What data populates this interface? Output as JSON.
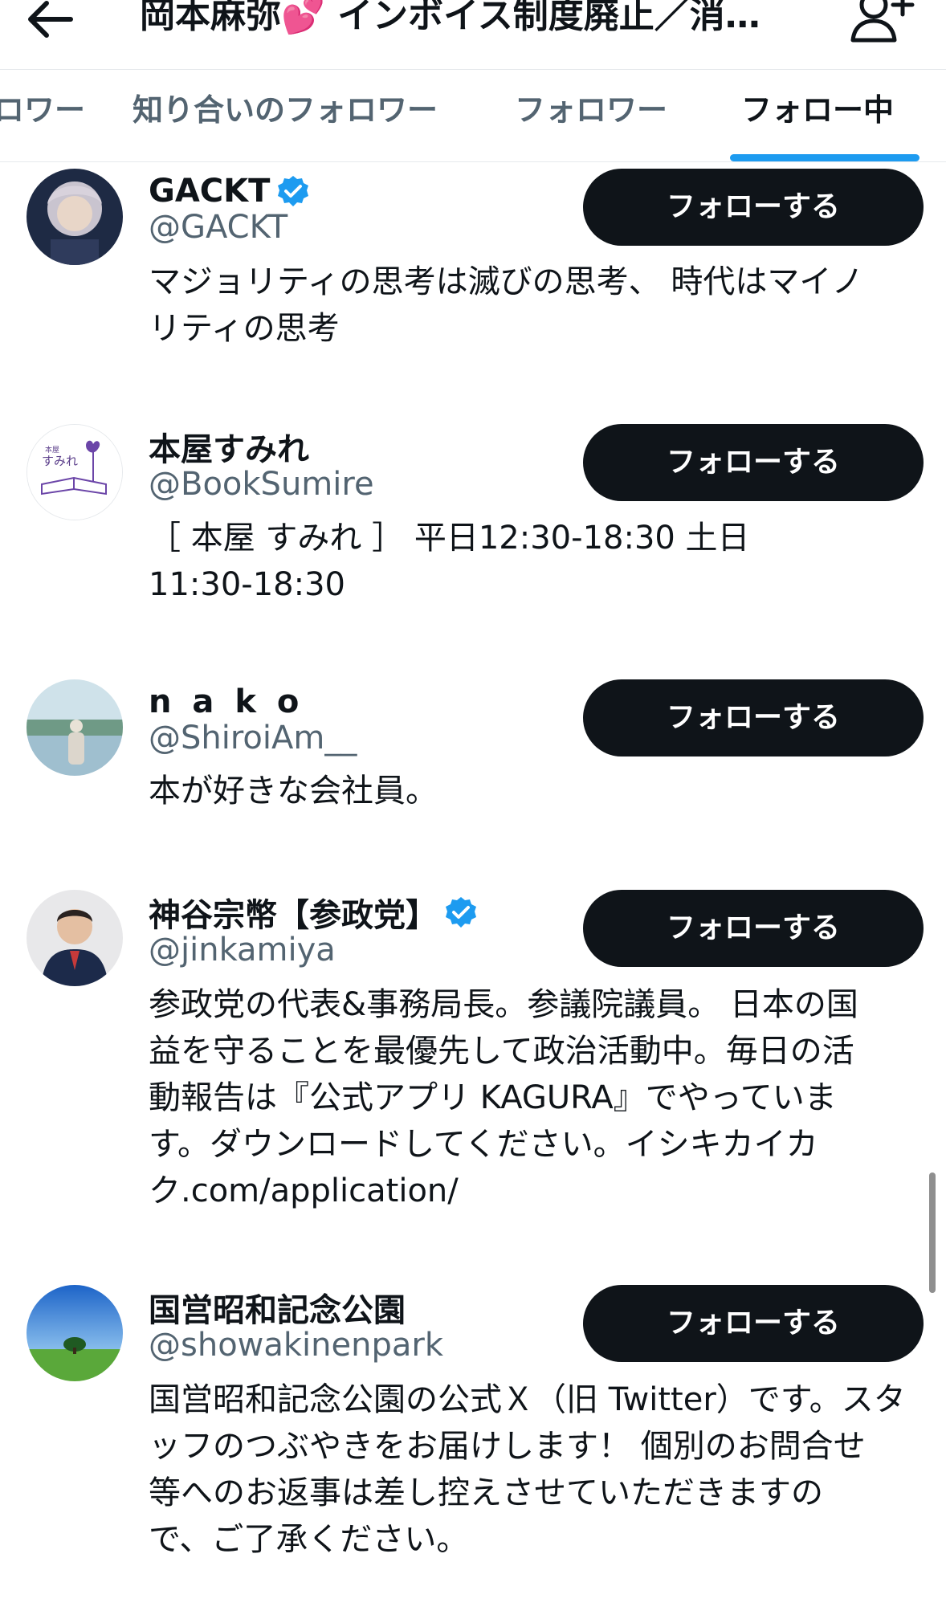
{
  "header": {
    "title": "岡本麻弥💕 インボイス制度廃止／消…"
  },
  "tabs": [
    {
      "label": "ロワー"
    },
    {
      "label": "知り合いのフォロワー"
    },
    {
      "label": "フォロワー"
    },
    {
      "label": "フォロー中"
    }
  ],
  "users": [
    {
      "name": "GACKT",
      "handle": "@GACKT",
      "verified": true,
      "button": "フォローする",
      "bio": [
        "マジョリティの思考は滅びの思考、 時代はマイノ",
        "リティの思考"
      ]
    },
    {
      "name": "本屋すみれ",
      "handle": "@BookSumire",
      "verified": false,
      "button": "フォローする",
      "bio": [
        "［ 本屋 すみれ ］ 平日12:30-18:30 土日",
        "11:30-18:30"
      ],
      "avatar_text": [
        "本屋",
        "すみれ"
      ]
    },
    {
      "name": "n a k o",
      "handle": "@ShiroiAm__",
      "verified": false,
      "button": "フォローする",
      "bio": [
        "本が好きな会社員。"
      ]
    },
    {
      "name": "神谷宗幣【参政党】",
      "handle": "@jinkamiya",
      "verified": true,
      "button": "フォローする",
      "bio": [
        "参政党の代表&事務局長。参議院議員。 日本の国",
        "益を守ることを最優先して政治活動中。毎日の活",
        "動報告は『公式アプリ KAGURA』でやっていま",
        "す。ダウンロードしてください。イシキカイカ",
        "ク.com/application/"
      ]
    },
    {
      "name": "国営昭和記念公園",
      "handle": "@showakinenpark",
      "verified": false,
      "button": "フォローする",
      "bio": [
        "国営昭和記念公園の公式Ｘ（旧 Twitter）です。スタ",
        "ッフのつぶやきをお届けします！ 個別のお問合せ",
        "等へのお返事は差し控えさせていただきますの",
        "で、ご了承ください。"
      ]
    }
  ],
  "colors": {
    "accent": "#1d9bf0",
    "button_bg": "#0f1419",
    "secondary_text": "#536471"
  },
  "icons": {
    "back": "arrow-left-icon",
    "add_user": "add-user-icon",
    "verified": "verified-badge-icon"
  }
}
